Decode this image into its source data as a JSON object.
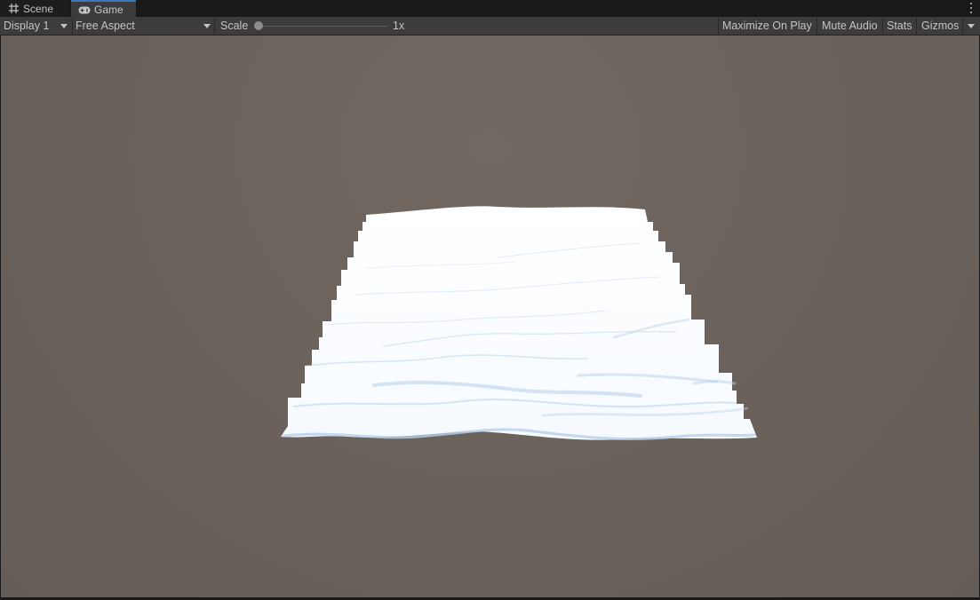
{
  "tabs": [
    {
      "label": "Scene",
      "icon": "grid-icon",
      "active": false
    },
    {
      "label": "Game",
      "icon": "gamepad-icon",
      "active": true
    }
  ],
  "toolbar": {
    "display_label": "Display 1",
    "aspect_label": "Free Aspect",
    "scale_label": "Scale",
    "scale_value": "1x",
    "scale_level": 0,
    "maximize_label": "Maximize On Play",
    "mute_label": "Mute Audio",
    "stats_label": "Stats",
    "gizmos_label": "Gizmos"
  },
  "colors": {
    "accent": "#3a79bb",
    "toolbar_bg": "#3c3c3c",
    "viewport_bg": "#6a615b",
    "mesh_white": "#ffffff",
    "mesh_shadow": "#a9c7e8"
  }
}
